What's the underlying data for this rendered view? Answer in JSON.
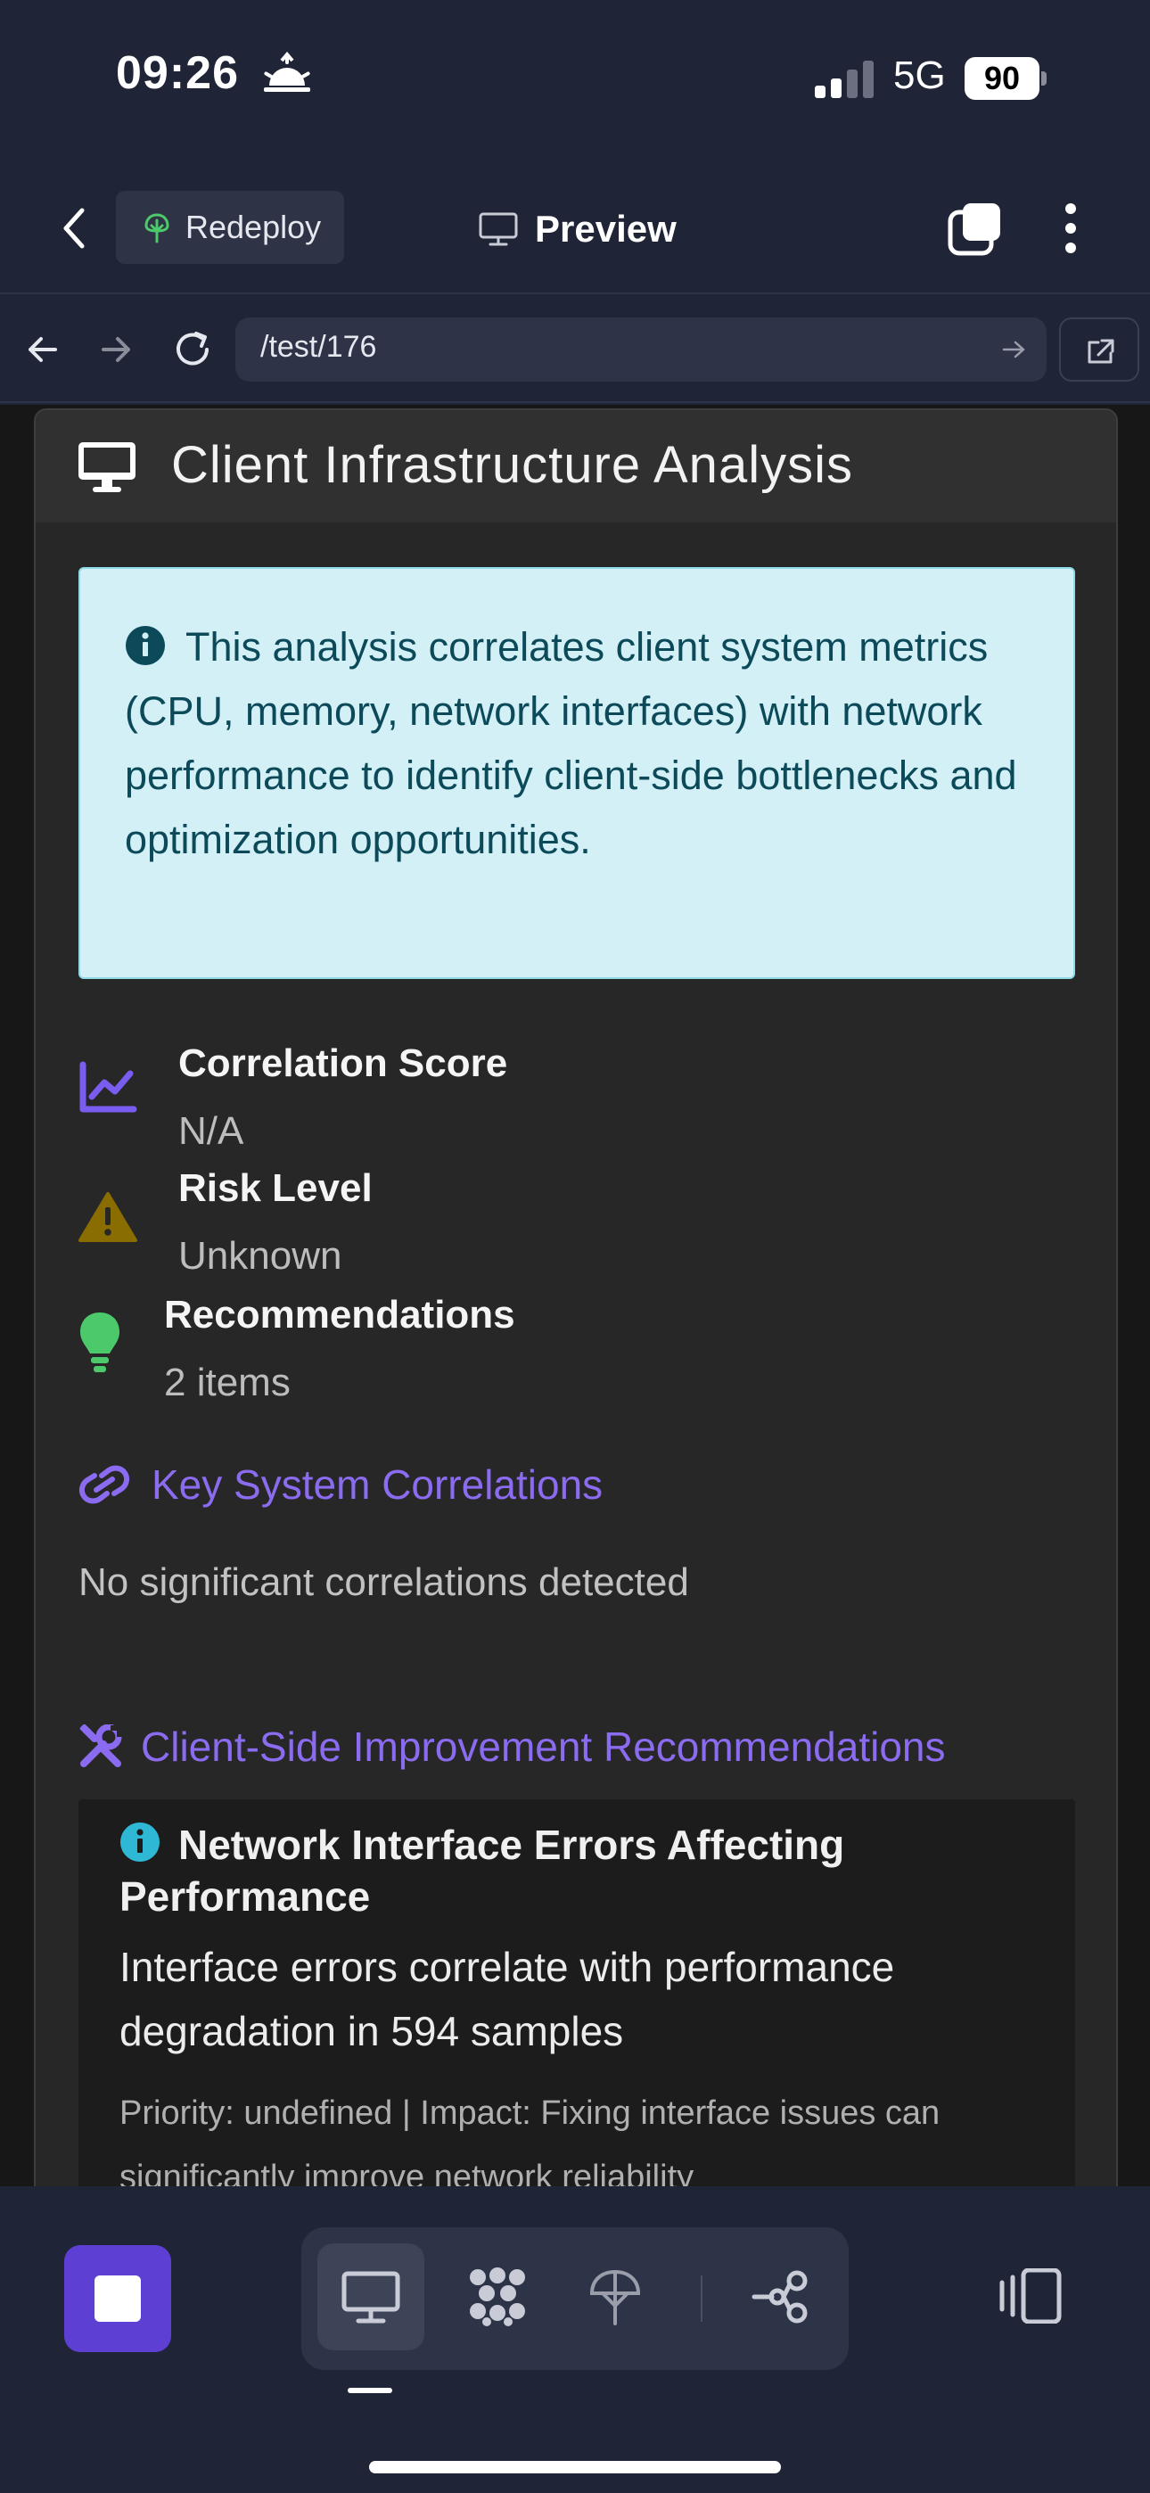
{
  "status_bar": {
    "time": "09:26",
    "network": "5G",
    "battery": "90"
  },
  "toolbar": {
    "redeploy_label": "Redeploy",
    "preview_label": "Preview"
  },
  "browser": {
    "url": "/test/176"
  },
  "card": {
    "title": "Client Infrastructure Analysis",
    "info_text": "This analysis correlates client system metrics (CPU, memory, network interfaces) with network performance to identify client-side bottlenecks and optimization opportunities.",
    "metrics": [
      {
        "title": "Correlation Score",
        "value": "N/A",
        "icon": "chart-line-icon",
        "color": "#7b5cf0"
      },
      {
        "title": "Risk Level",
        "value": "Unknown",
        "icon": "warning-triangle-icon",
        "color": "#8a6d00"
      },
      {
        "title": "Recommendations",
        "value": "2 items",
        "icon": "lightbulb-icon",
        "color": "#4cc96a"
      }
    ],
    "correlations_heading": "Key System Correlations",
    "correlations_empty": "No significant correlations detected",
    "recommendations_heading": "Client-Side Improvement Recommendations",
    "recommendation": {
      "title": "Network Interface Errors Affecting Performance",
      "description": "Interface errors correlate with performance degradation in 594 samples",
      "meta": "Priority: undefined | Impact: Fixing interface issues can significantly improve network reliability"
    }
  },
  "colors": {
    "accent": "#8b6cf0",
    "info_bg": "#d3f0f6",
    "info_text": "#0c4a5a",
    "stop_button": "#5d3fd3"
  }
}
